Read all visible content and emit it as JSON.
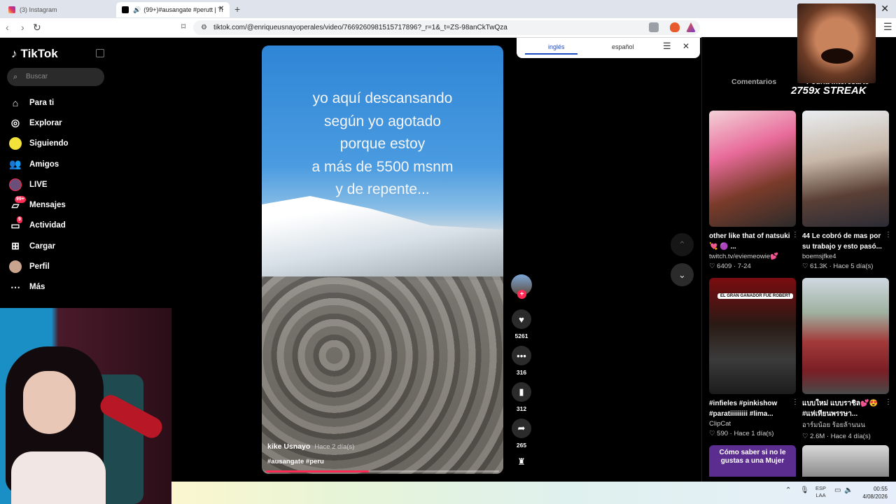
{
  "browser": {
    "tabs": [
      {
        "title": "(3) Instagram"
      },
      {
        "title": "(99+)#ausangate #perutt | Ti"
      }
    ],
    "new_tab": "+",
    "close_window": "✕",
    "url": "tiktok.com/@enriqueusnayoperales/video/7669260981515717896?_r=1&_t=ZS-98anCkTwQza"
  },
  "translate_popup": {
    "lang_from": "inglés",
    "lang_to": "español"
  },
  "sidebar": {
    "brand": "TikTok",
    "search_placeholder": "Buscar",
    "items": [
      {
        "label": "Para ti",
        "icon": "home-icon"
      },
      {
        "label": "Explorar",
        "icon": "compass-icon"
      },
      {
        "label": "Siguiendo",
        "icon": "following-icon"
      },
      {
        "label": "Amigos",
        "icon": "friends-icon"
      },
      {
        "label": "LIVE",
        "icon": "live-icon"
      },
      {
        "label": "Mensajes",
        "icon": "messages-icon",
        "badge": "99+"
      },
      {
        "label": "Actividad",
        "icon": "activity-icon",
        "badge": "9"
      },
      {
        "label": "Cargar",
        "icon": "upload-icon"
      },
      {
        "label": "Perfil",
        "icon": "profile-icon"
      },
      {
        "label": "Más",
        "icon": "more-icon"
      }
    ]
  },
  "video": {
    "overlay_lines": [
      "yo aquí descansando",
      "según yo agotado",
      "porque estoy",
      "a más de 5500 msnm",
      "y de repente..."
    ],
    "author": "kike Usnayo",
    "time_ago": "Hace 2 día(s)",
    "tags": "#ausangate #peru",
    "progress": 0.44
  },
  "actions": {
    "likes": "5261",
    "comments": "316",
    "saves": "312",
    "shares": "265"
  },
  "right_panel": {
    "tab_comments": "Comentarios",
    "tab_interesting": "Podría interesarte",
    "cards": [
      {
        "title": "other like that of natsuki 💘 🟣 ...",
        "user": "twitch.tv/eviemeowie💕",
        "meta": "♡ 6409 · 7-24"
      },
      {
        "title": "44 Le cobró de mas por su trabajo y esto pasó...",
        "user": "boemsjfke4",
        "meta": "♡ 61.3K · Hace 5 día(s)"
      },
      {
        "title": "#infieles #pinkishow #paratiiiiiiiii #lima...",
        "user": "ClipCat",
        "meta": "♡ 590 · Hace 1 día(s)",
        "thumb_caption": "EL GRAN GANADOR FUE ROBERT"
      },
      {
        "title": "แบบใหม่ แบบราชิล💕😍 #แห่เทียนพรรษา...",
        "user": "อาร์มน้อย ร้อยล้านนน",
        "meta": "♡ 2.6M · Hace 4 día(s)"
      }
    ],
    "bottom_caption": "Cómo saber si no le gustas a una Mujer"
  },
  "overlay": {
    "streak": "2759x STREAK"
  },
  "taskbar": {
    "lang": "ESP",
    "lang2": "LAA",
    "time": "00:55",
    "date": "4/08/2026"
  }
}
